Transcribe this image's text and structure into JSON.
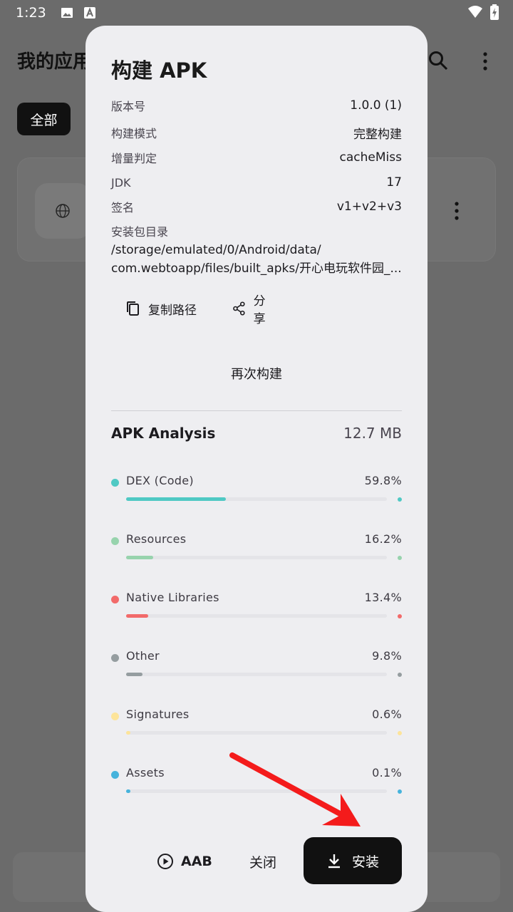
{
  "status_bar": {
    "time": "1:23"
  },
  "background": {
    "title": "我的应用",
    "filter_chip": "全部"
  },
  "dialog": {
    "title": "构建 APK",
    "info": [
      {
        "label": "版本号",
        "value": "1.0.0 (1)"
      },
      {
        "label": "构建模式",
        "value": "完整构建"
      },
      {
        "label": "增量判定",
        "value": "cacheMiss"
      },
      {
        "label": "JDK",
        "value": "17"
      },
      {
        "label": "签名",
        "value": "v1+v2+v3"
      }
    ],
    "path_label": "安装包目录",
    "path_line1": "/storage/emulated/0/Android/data/",
    "path_line2": "com.webtoapp/files/built_apks/开心电玩软件园_...",
    "copy_path_label": "复制路径",
    "share_label": "分享",
    "rebuild_label": "再次构建",
    "analysis": {
      "title": "APK Analysis",
      "size": "12.7 MB",
      "items": [
        {
          "name": "DEX (Code)",
          "percent": "59.8%",
          "value": 59.8,
          "color": "#4fc9c4"
        },
        {
          "name": "Resources",
          "percent": "16.2%",
          "value": 16.2,
          "color": "#97d3ad"
        },
        {
          "name": "Native Libraries",
          "percent": "13.4%",
          "value": 13.4,
          "color": "#f26a6a"
        },
        {
          "name": "Other",
          "percent": "9.8%",
          "value": 9.8,
          "color": "#959da0"
        },
        {
          "name": "Signatures",
          "percent": "0.6%",
          "value": 0.6,
          "color": "#fde49a"
        },
        {
          "name": "Assets",
          "percent": "0.1%",
          "value": 0.1,
          "color": "#46b3dc"
        }
      ]
    },
    "actions": {
      "aab_label": "AAB",
      "close_label": "关闭",
      "install_label": "安装"
    }
  },
  "icons": {
    "search": "search-icon",
    "more": "more-vert-icon",
    "copy": "copy-icon",
    "share": "share-icon",
    "play": "play-circle-icon",
    "download": "download-icon"
  }
}
